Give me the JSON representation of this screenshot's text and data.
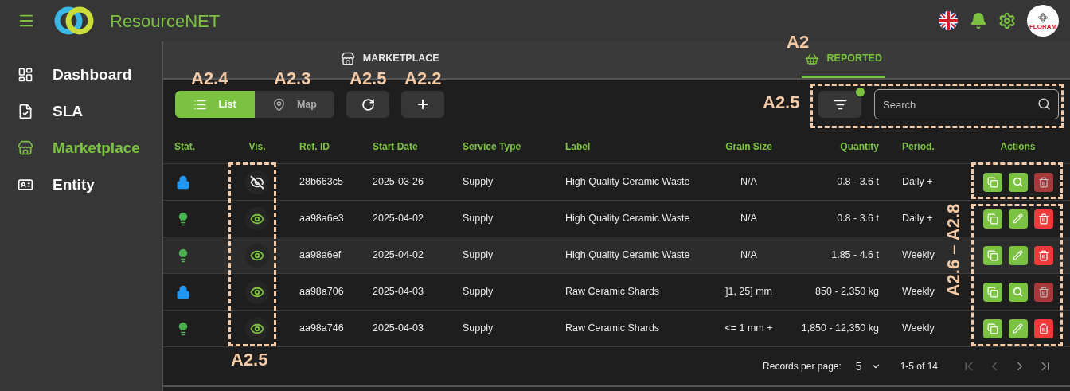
{
  "app": {
    "title": "ResourceNET",
    "avatar_text": "FLORAM"
  },
  "sidebar": {
    "items": [
      {
        "label": "Dashboard",
        "selected": false
      },
      {
        "label": "SLA",
        "selected": false
      },
      {
        "label": "Marketplace",
        "selected": true
      },
      {
        "label": "Entity",
        "selected": false
      }
    ]
  },
  "tabs": [
    {
      "label": "MARKETPLACE",
      "selected": false
    },
    {
      "label": "REPORTED",
      "selected": true
    }
  ],
  "view_toggle": [
    {
      "label": "List",
      "selected": true
    },
    {
      "label": "Map",
      "selected": false
    }
  ],
  "toolbar": {
    "filter_active": true,
    "search_placeholder": "Search"
  },
  "table": {
    "columns": [
      "Stat.",
      "Vis.",
      "Ref. ID",
      "Start Date",
      "Service Type",
      "Label",
      "Grain Size",
      "Quantity",
      "Period.",
      "Actions"
    ],
    "rows": [
      {
        "kind": "locked",
        "visible": false,
        "selected": false,
        "ref_id": "28b663c5",
        "start_date": "2025-03-26",
        "service_type": "Supply",
        "label": "High Quality Ceramic Waste",
        "grain_size": "N/A",
        "quantity": "0.8 - 3.6 t",
        "period": "Daily +",
        "editable": false,
        "deletable": false
      },
      {
        "kind": "active",
        "visible": true,
        "selected": false,
        "ref_id": "aa98a6e3",
        "start_date": "2025-04-02",
        "service_type": "Supply",
        "label": "High Quality Ceramic Waste",
        "grain_size": "N/A",
        "quantity": "0.8 - 3.6 t",
        "period": "Daily +",
        "editable": true,
        "deletable": true
      },
      {
        "kind": "active",
        "visible": true,
        "selected": true,
        "ref_id": "aa98a6ef",
        "start_date": "2025-04-02",
        "service_type": "Supply",
        "label": "High Quality Ceramic Waste",
        "grain_size": "N/A",
        "quantity": "1.85 - 4.6 t",
        "period": "Weekly",
        "editable": true,
        "deletable": true
      },
      {
        "kind": "locked",
        "visible": true,
        "selected": false,
        "ref_id": "aa98a706",
        "start_date": "2025-04-03",
        "service_type": "Supply",
        "label": "Raw Ceramic Shards",
        "grain_size": "]1, 25] mm",
        "quantity": "850 - 2,350 kg",
        "period": "Weekly",
        "editable": false,
        "deletable": false
      },
      {
        "kind": "active",
        "visible": true,
        "selected": false,
        "ref_id": "aa98a746",
        "start_date": "2025-04-03",
        "service_type": "Supply",
        "label": "Raw Ceramic Shards",
        "grain_size": "<= 1 mm +",
        "quantity": "1,850 - 12,350 kg",
        "period": "Weekly",
        "editable": true,
        "deletable": true
      }
    ]
  },
  "pagination": {
    "records_label": "Records per page:",
    "per_page": "5",
    "range": "1-5 of 14",
    "first_disabled": true,
    "prev_disabled": true,
    "next_disabled": false,
    "last_disabled": false
  },
  "callouts": [
    "A2",
    "A2.4",
    "A2.3",
    "A2.5",
    "A2.2",
    "A2.5",
    "A2.5",
    "A2.6 – A2.8"
  ]
}
